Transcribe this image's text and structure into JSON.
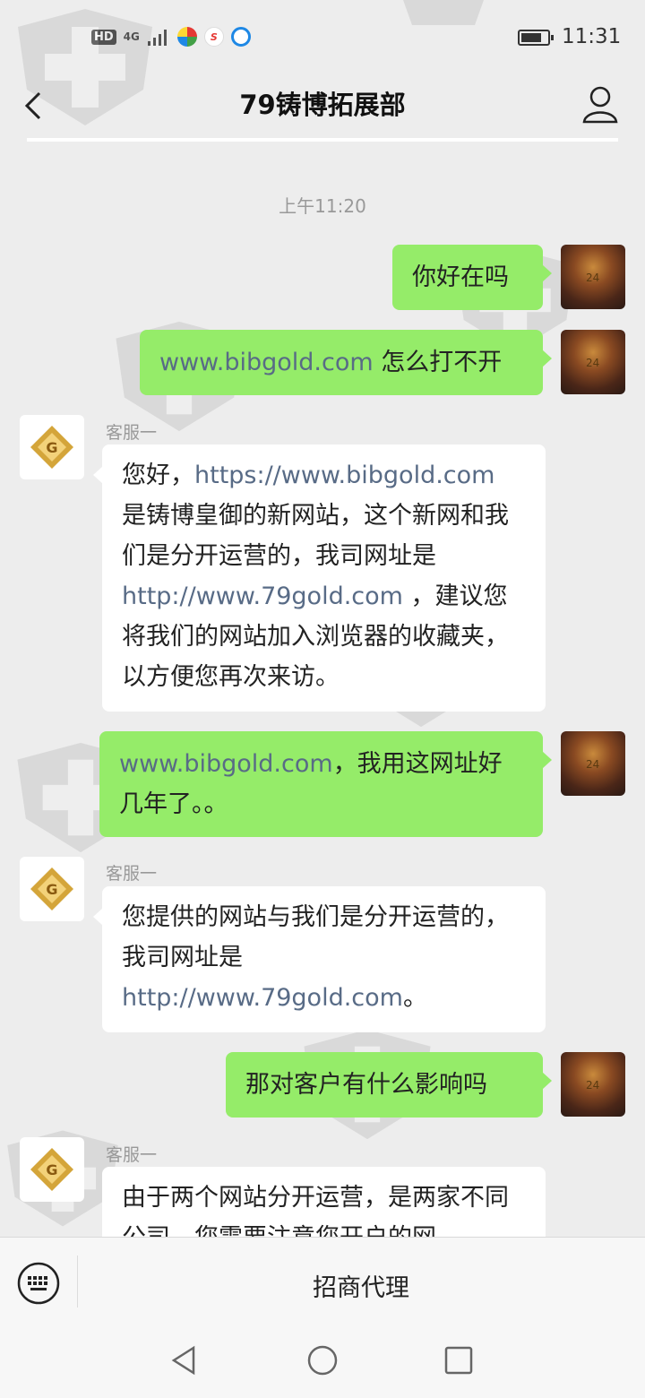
{
  "status_bar": {
    "hd": "HD",
    "network": "4G",
    "time": "11:31"
  },
  "header": {
    "title": "79铸博拓展部",
    "back_icon": "chevron-left-icon",
    "profile_icon": "user-icon"
  },
  "chat": {
    "timestamp": "上午11:20",
    "messages": [
      {
        "from": "me",
        "parts": [
          {
            "text": "你好在吗"
          }
        ]
      },
      {
        "from": "me",
        "parts": [
          {
            "text": "www.bibgold.com",
            "link": true
          },
          {
            "text": " 怎么打不开"
          }
        ]
      },
      {
        "from": "cs",
        "sender": "客服一",
        "parts": [
          {
            "text": "您好，"
          },
          {
            "text": "https://www.bibgold.com",
            "link": true
          },
          {
            "text": " 是铸博皇御的新网站，这个新网和我们是分开运营的，我司网址是 "
          },
          {
            "text": "http://www.79gold.com",
            "link": true
          },
          {
            "text": " ，建议您将我们的网站加入浏览器的收藏夹，以方便您再次来访。"
          }
        ]
      },
      {
        "from": "me",
        "parts": [
          {
            "text": "www.bibgold.com",
            "link": true
          },
          {
            "text": "，我用这网址好几年了。。"
          }
        ]
      },
      {
        "from": "cs",
        "sender": "客服一",
        "parts": [
          {
            "text": "您提供的网站与我们是分开运营的，我司网址是 "
          },
          {
            "text": "http://www.79gold.com",
            "link": true
          },
          {
            "text": "。"
          }
        ]
      },
      {
        "from": "me",
        "parts": [
          {
            "text": "那对客户有什么影响吗"
          }
        ]
      },
      {
        "from": "cs",
        "sender": "客服一",
        "parts": [
          {
            "text": "由于两个网站分开运营，是两家不同公司，您需要注意您开户的网"
          }
        ]
      }
    ]
  },
  "bottom_bar": {
    "keyboard_icon": "keyboard-icon",
    "menu_label": "招商代理"
  },
  "nav": {
    "back_icon": "triangle-back-icon",
    "home_icon": "circle-home-icon",
    "recents_icon": "square-recents-icon"
  },
  "colors": {
    "my_bubble": "#95ec69",
    "link": "#586b86",
    "background": "#ededed"
  }
}
